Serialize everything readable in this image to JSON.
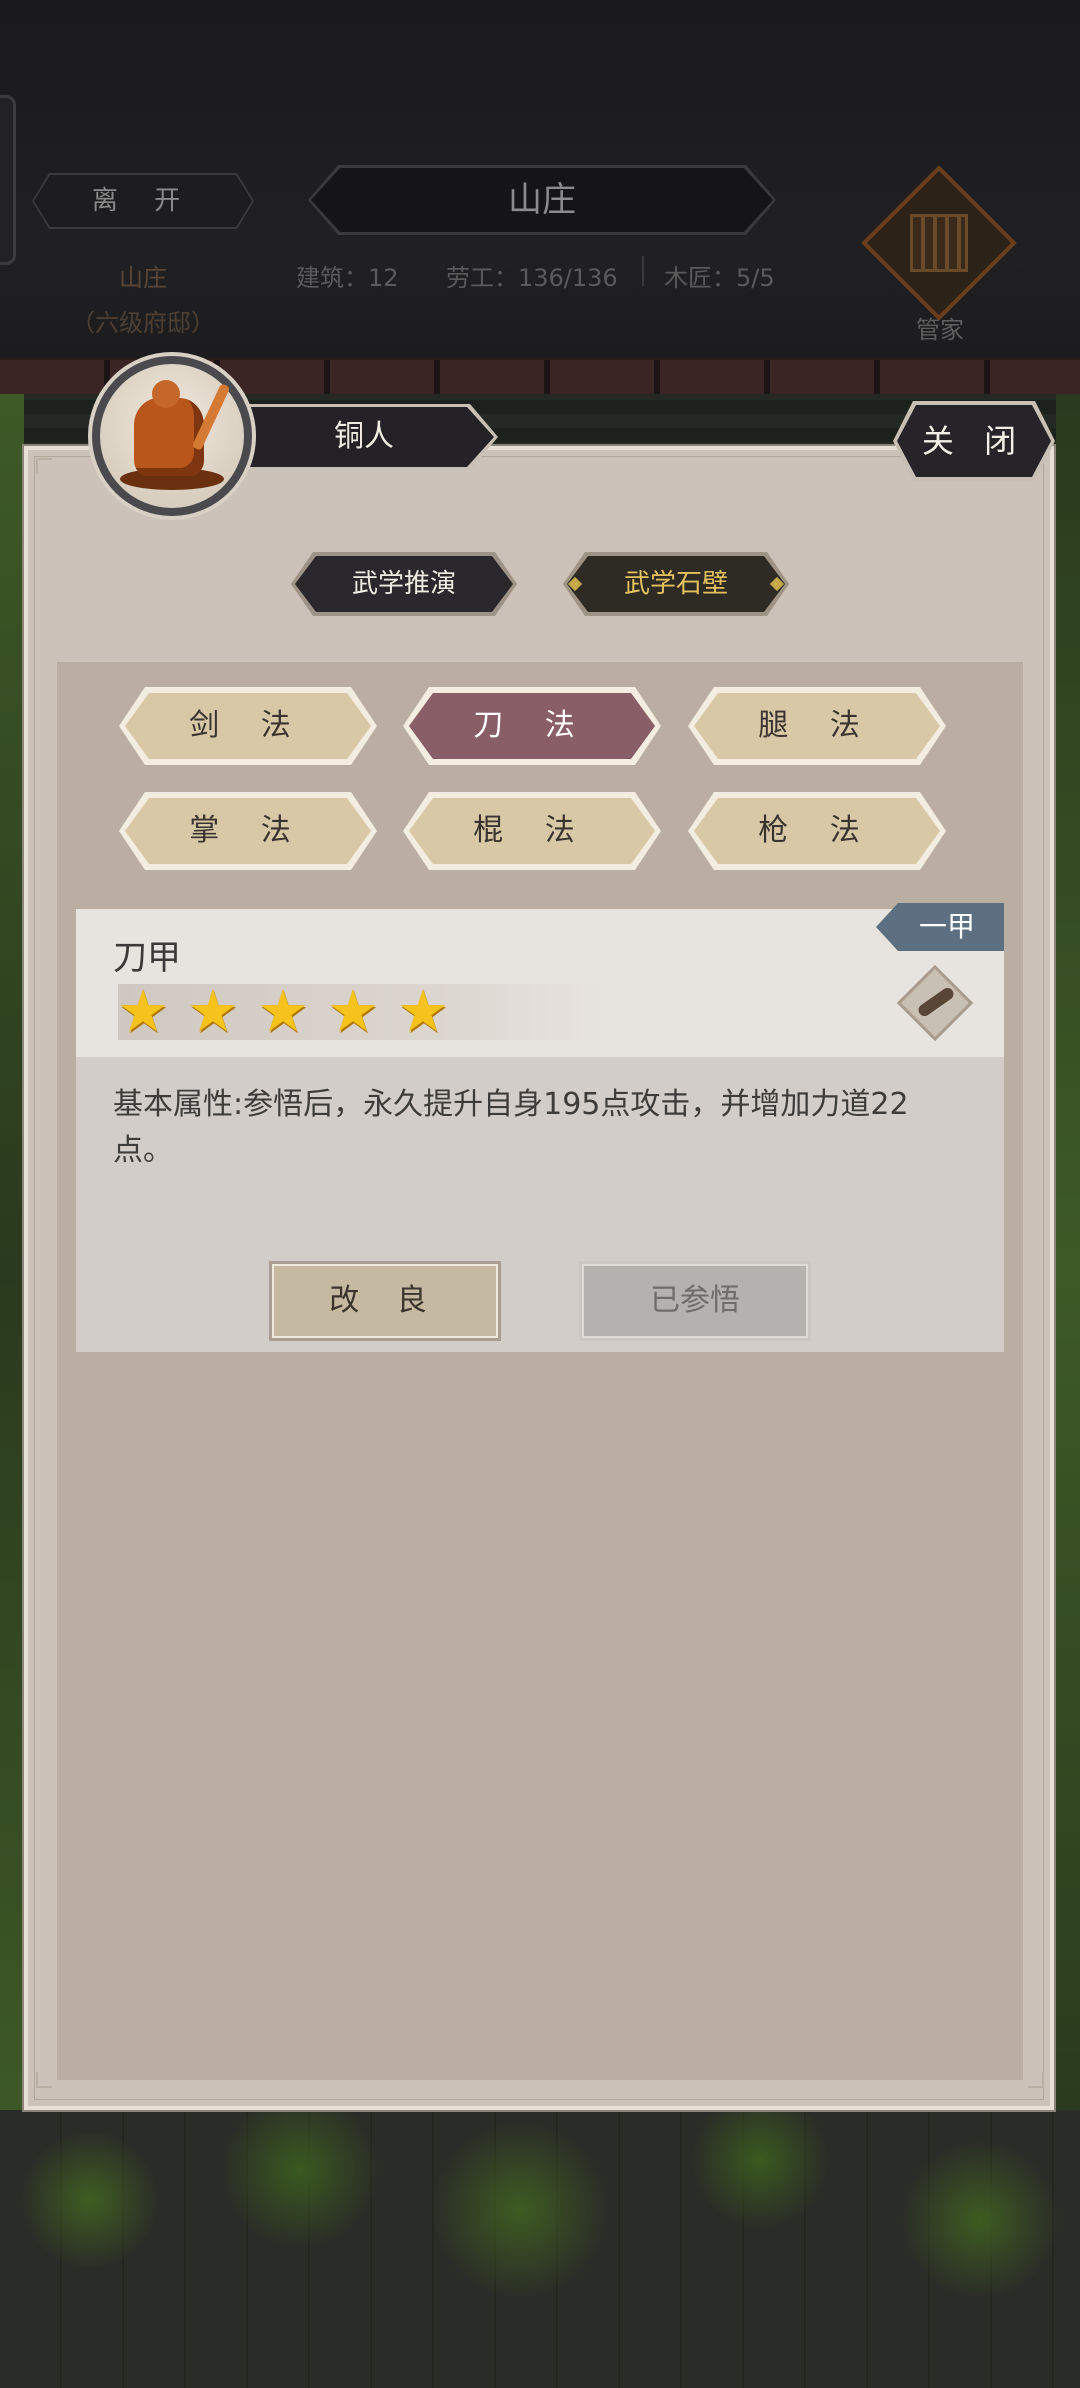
{
  "header": {
    "leave_label": "离 开",
    "estate_name": "山庄",
    "estate_level": "（六级府邸）",
    "title": "山庄",
    "buildings": "建筑：12",
    "workers": "劳工：136/136",
    "carpenters": "木匠：5/5",
    "steward_label": "管家",
    "steward_icon": "abacus-icon"
  },
  "dialog": {
    "npc_name": "铜人",
    "close_label": "关 闭",
    "modes": [
      {
        "label": "武学推演",
        "active": false
      },
      {
        "label": "武学石壁",
        "active": true
      }
    ],
    "categories": [
      {
        "label": "剑 法",
        "active": false
      },
      {
        "label": "刀 法",
        "active": true
      },
      {
        "label": "腿 法",
        "active": false
      },
      {
        "label": "掌 法",
        "active": false
      },
      {
        "label": "棍 法",
        "active": false
      },
      {
        "label": "枪 法",
        "active": false
      }
    ],
    "skill": {
      "name": "刀甲",
      "rank": "一甲",
      "stars": 5,
      "max_stars": 5,
      "description": "基本属性:参悟后，永久提升自身195点攻击，并增加力道22点。",
      "improve_label": "改 良",
      "comprehended_label": "已参悟",
      "icon": "blade-manual-icon"
    }
  },
  "colors": {
    "panel": "#ccc2b9",
    "content": "#b9aea1",
    "active_category": "#8a5e66",
    "category": "#d8c8a6",
    "rank_badge": "#5c7081",
    "star": "#f6c21c"
  }
}
